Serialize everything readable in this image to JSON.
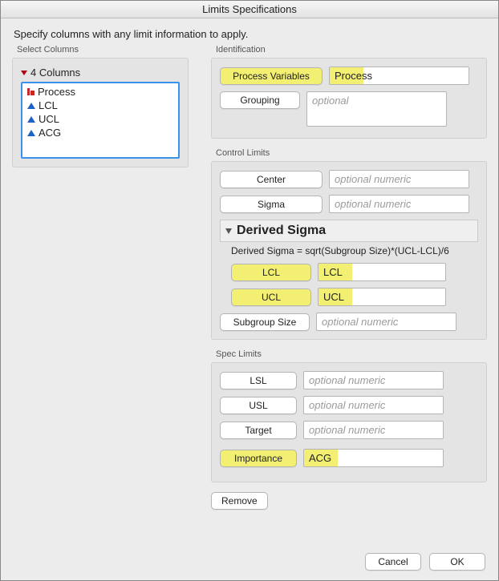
{
  "window": {
    "title": "Limits Specifications"
  },
  "instruction": "Specify columns with any limit information to apply.",
  "columnsPanel": {
    "label": "Select Columns",
    "header": "4 Columns",
    "items": [
      {
        "name": "Process",
        "type": "nominal"
      },
      {
        "name": "LCL",
        "type": "continuous"
      },
      {
        "name": "UCL",
        "type": "continuous"
      },
      {
        "name": "ACG",
        "type": "continuous"
      }
    ]
  },
  "identification": {
    "label": "Identification",
    "processVars": {
      "button": "Process Variables",
      "value": "Process"
    },
    "grouping": {
      "button": "Grouping",
      "placeholder": "optional"
    }
  },
  "controlLimits": {
    "label": "Control Limits",
    "center": {
      "button": "Center",
      "placeholder": "optional numeric"
    },
    "sigma": {
      "button": "Sigma",
      "placeholder": "optional numeric"
    },
    "derived": {
      "title": "Derived Sigma",
      "formula": "Derived Sigma = sqrt(Subgroup Size)*(UCL-LCL)/6",
      "lcl": {
        "button": "LCL",
        "value": "LCL"
      },
      "ucl": {
        "button": "UCL",
        "value": "UCL"
      },
      "subgroup": {
        "button": "Subgroup Size",
        "placeholder": "optional numeric"
      }
    }
  },
  "specLimits": {
    "label": "Spec Limits",
    "lsl": {
      "button": "LSL",
      "placeholder": "optional numeric"
    },
    "usl": {
      "button": "USL",
      "placeholder": "optional numeric"
    },
    "target": {
      "button": "Target",
      "placeholder": "optional numeric"
    },
    "importance": {
      "button": "Importance",
      "value": "ACG"
    }
  },
  "actions": {
    "remove": "Remove",
    "cancel": "Cancel",
    "ok": "OK"
  },
  "colors": {
    "highlight": "#f2ef73"
  }
}
